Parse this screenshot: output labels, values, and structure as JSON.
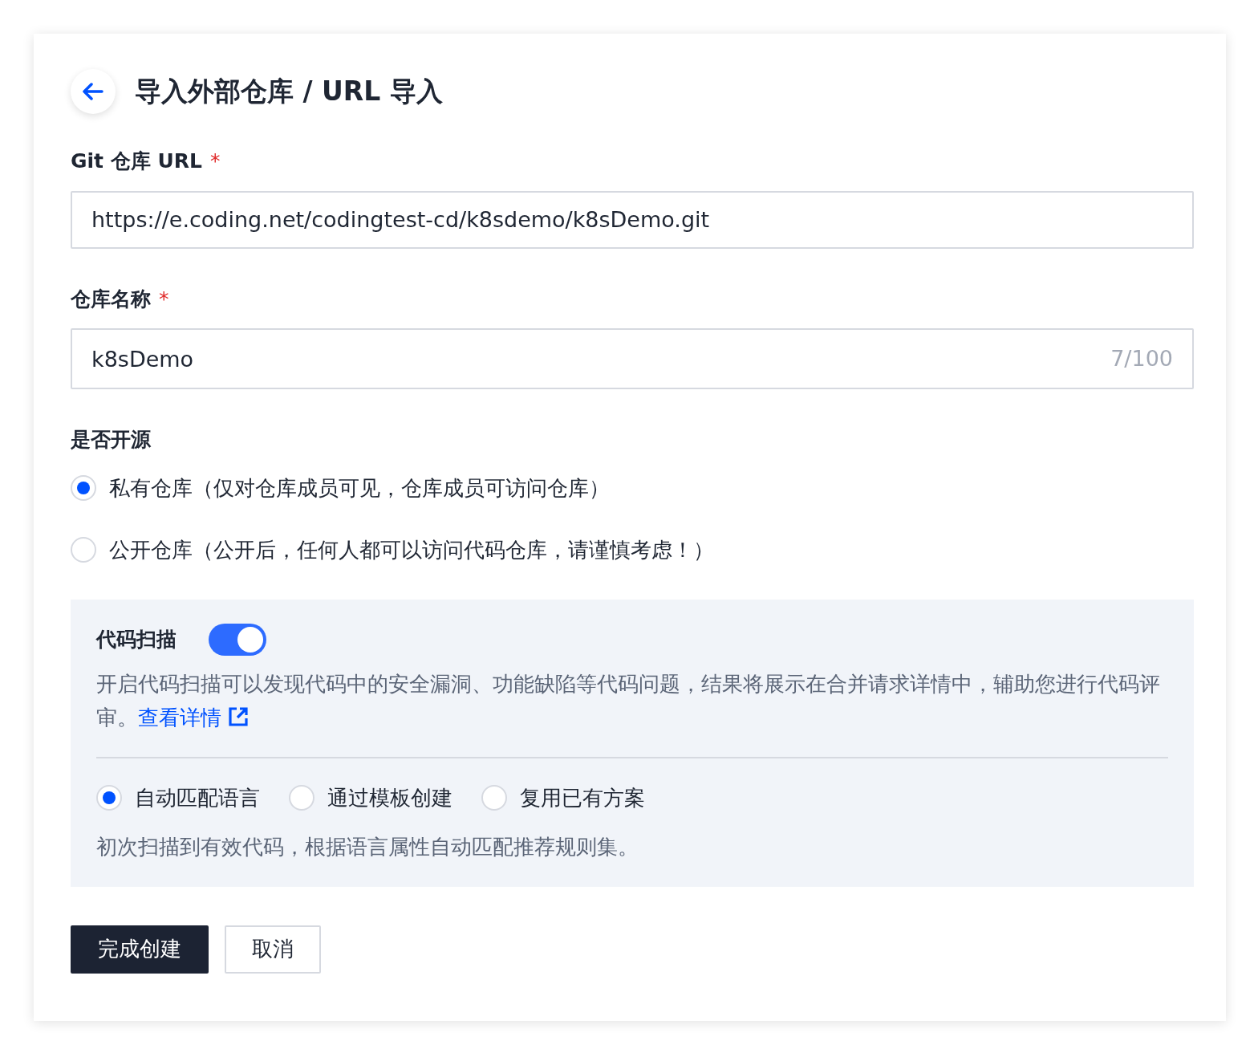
{
  "header": {
    "title": "导入外部仓库 / URL 导入"
  },
  "url_field": {
    "label": "Git 仓库 URL",
    "required_mark": "*",
    "value": "https://e.coding.net/codingtest-cd/k8sdemo/k8sDemo.git"
  },
  "name_field": {
    "label": "仓库名称",
    "required_mark": "*",
    "value": "k8sDemo",
    "counter": "7/100"
  },
  "visibility": {
    "label": "是否开源",
    "options": [
      {
        "label": "私有仓库（仅对仓库成员可见，仓库成员可访问仓库）",
        "selected": true
      },
      {
        "label": "公开仓库（公开后，任何人都可以访问代码仓库，请谨慎考虑！）",
        "selected": false
      }
    ]
  },
  "code_scan": {
    "title": "代码扫描",
    "on": true,
    "description": "开启代码扫描可以发现代码中的安全漏洞、功能缺陷等代码问题，结果将展示在合并请求详情中，辅助您进行代码评审。",
    "link": "查看详情",
    "modes": [
      {
        "label": "自动匹配语言",
        "selected": true
      },
      {
        "label": "通过模板创建",
        "selected": false
      },
      {
        "label": "复用已有方案",
        "selected": false
      }
    ],
    "mode_hint": "初次扫描到有效代码，根据语言属性自动匹配推荐规则集。"
  },
  "buttons": [
    {
      "label": "完成创建",
      "kind": "primary"
    },
    {
      "label": "取消",
      "kind": "secondary"
    }
  ]
}
